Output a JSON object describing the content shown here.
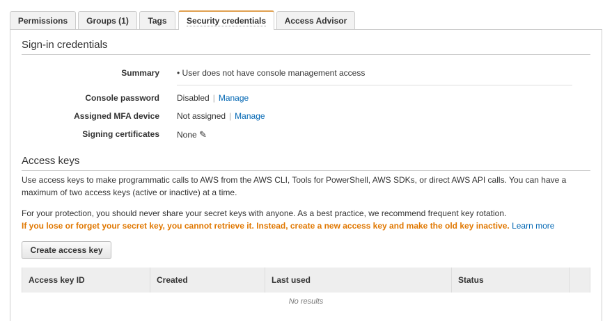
{
  "tabs": [
    "Permissions",
    "Groups (1)",
    "Tags",
    "Security credentials",
    "Access Advisor"
  ],
  "signin": {
    "title": "Sign-in credentials",
    "summary_label": "Summary",
    "summary_value": "• User does not have console management access",
    "console_label": "Console password",
    "console_value": "Disabled",
    "console_link": "Manage",
    "mfa_label": "Assigned MFA device",
    "mfa_value": "Not assigned",
    "mfa_link": "Manage",
    "certs_label": "Signing certificates",
    "certs_value": "None"
  },
  "access_keys": {
    "title": "Access keys",
    "desc": "Use access keys to make programmatic calls to AWS from the AWS CLI, Tools for PowerShell, AWS SDKs, or direct AWS API calls. You can have a maximum of two access keys (active or inactive) at a time.",
    "protection": "For your protection, you should never share your secret keys with anyone. As a best practice, we recommend frequent key rotation.",
    "warning": "If you lose or forget your secret key, you cannot retrieve it. Instead, create a new access key and make the old key inactive.",
    "learn_more": "Learn more",
    "create_button": "Create access key",
    "columns": [
      "Access key ID",
      "Created",
      "Last used",
      "Status"
    ],
    "empty": "No results"
  }
}
